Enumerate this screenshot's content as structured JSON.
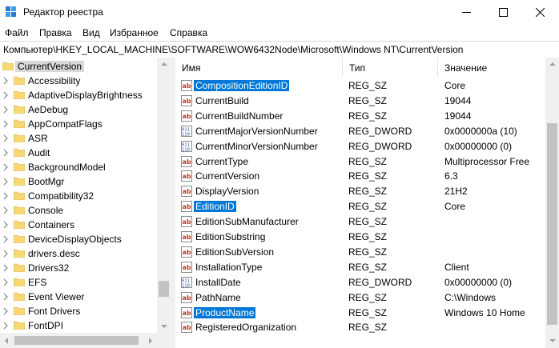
{
  "window": {
    "title": "Редактор реестра"
  },
  "menu": [
    "Файл",
    "Правка",
    "Вид",
    "Избранное",
    "Справка"
  ],
  "address": "Компьютер\\HKEY_LOCAL_MACHINE\\SOFTWARE\\WOW6432Node\\Microsoft\\Windows NT\\CurrentVersion",
  "tree": {
    "root": "CurrentVersion",
    "items": [
      "Accessibility",
      "AdaptiveDisplayBrightness",
      "AeDebug",
      "AppCompatFlags",
      "ASR",
      "Audit",
      "BackgroundModel",
      "BootMgr",
      "Compatibility32",
      "Console",
      "Containers",
      "DeviceDisplayObjects",
      "drivers.desc",
      "Drivers32",
      "EFS",
      "Event Viewer",
      "Font Drivers",
      "FontDPI"
    ]
  },
  "columns": {
    "name": "Имя",
    "type": "Тип",
    "value": "Значение"
  },
  "values": [
    {
      "name": "CompositionEditionID",
      "type": "REG_SZ",
      "value": "Core",
      "icon": "string-value-icon",
      "selected": true
    },
    {
      "name": "CurrentBuild",
      "type": "REG_SZ",
      "value": "19044",
      "icon": "string-value-icon",
      "selected": false
    },
    {
      "name": "CurrentBuildNumber",
      "type": "REG_SZ",
      "value": "19044",
      "icon": "string-value-icon",
      "selected": false
    },
    {
      "name": "CurrentMajorVersionNumber",
      "type": "REG_DWORD",
      "value": "0x0000000a (10)",
      "icon": "binary-value-icon",
      "selected": false
    },
    {
      "name": "CurrentMinorVersionNumber",
      "type": "REG_DWORD",
      "value": "0x00000000 (0)",
      "icon": "binary-value-icon",
      "selected": false
    },
    {
      "name": "CurrentType",
      "type": "REG_SZ",
      "value": "Multiprocessor Free",
      "icon": "string-value-icon",
      "selected": false
    },
    {
      "name": "CurrentVersion",
      "type": "REG_SZ",
      "value": "6.3",
      "icon": "string-value-icon",
      "selected": false
    },
    {
      "name": "DisplayVersion",
      "type": "REG_SZ",
      "value": "21H2",
      "icon": "string-value-icon",
      "selected": false
    },
    {
      "name": "EditionID",
      "type": "REG_SZ",
      "value": "Core",
      "icon": "string-value-icon",
      "selected": true
    },
    {
      "name": "EditionSubManufacturer",
      "type": "REG_SZ",
      "value": "",
      "icon": "string-value-icon",
      "selected": false
    },
    {
      "name": "EditionSubstring",
      "type": "REG_SZ",
      "value": "",
      "icon": "string-value-icon",
      "selected": false
    },
    {
      "name": "EditionSubVersion",
      "type": "REG_SZ",
      "value": "",
      "icon": "string-value-icon",
      "selected": false
    },
    {
      "name": "InstallationType",
      "type": "REG_SZ",
      "value": "Client",
      "icon": "string-value-icon",
      "selected": false
    },
    {
      "name": "InstallDate",
      "type": "REG_DWORD",
      "value": "0x00000000 (0)",
      "icon": "binary-value-icon",
      "selected": false
    },
    {
      "name": "PathName",
      "type": "REG_SZ",
      "value": "C:\\Windows",
      "icon": "string-value-icon",
      "selected": false
    },
    {
      "name": "ProductName",
      "type": "REG_SZ",
      "value": "Windows 10 Home",
      "icon": "string-value-icon",
      "selected": true
    },
    {
      "name": "RegisteredOrganization",
      "type": "REG_SZ",
      "value": "",
      "icon": "string-value-icon",
      "selected": false
    }
  ],
  "colors": {
    "selection": "#0078d7",
    "folder": "#f8d775",
    "tree_selection": "#d9d9d9",
    "scrollbar": "#f0f0f0"
  }
}
